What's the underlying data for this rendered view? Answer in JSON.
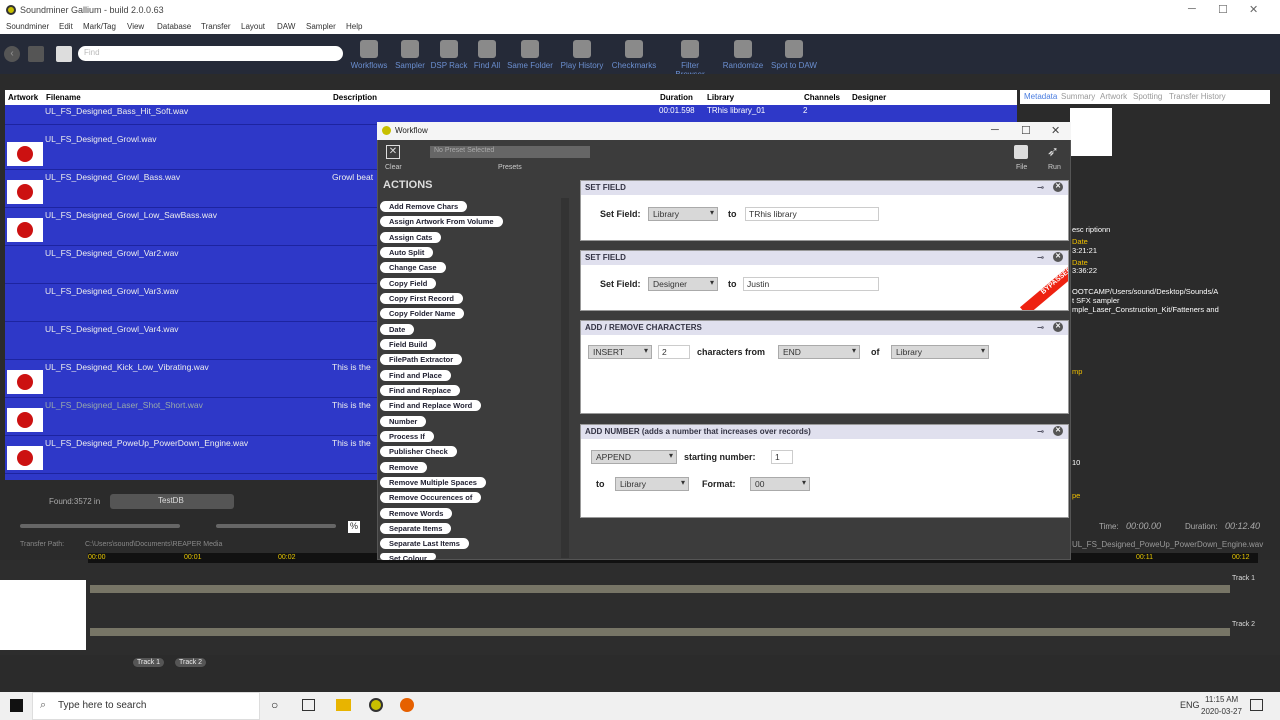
{
  "app": {
    "title": "Soundminer Gallium - build 2.0.0.63"
  },
  "menu": [
    "Soundminer",
    "Edit",
    "Mark/Tag",
    "View",
    "Database",
    "Transfer",
    "Layout",
    "DAW",
    "Sampler",
    "Help"
  ],
  "search": {
    "placeholder": "Find"
  },
  "toolbar": [
    "Workflows",
    "Sampler",
    "DSP Rack",
    "Find All",
    "Same Folder",
    "Play History",
    "Checkmarks",
    "Filter Browser",
    "Randomize",
    "Spot to DAW"
  ],
  "grid": {
    "columns": [
      "Artwork",
      "Filename",
      "Description",
      "Duration",
      "Library",
      "Channels",
      "Designer"
    ],
    "first": {
      "duration": "00:01.598",
      "library": "TRhis library_01",
      "channels": "2"
    },
    "rows": [
      {
        "file": "UL_FS_Designed_Bass_Hit_Soft.wav",
        "desc": ""
      },
      {
        "file": "UL_FS_Designed_Growl.wav",
        "desc": ""
      },
      {
        "file": "UL_FS_Designed_Growl_Bass.wav",
        "desc": "Growl beat"
      },
      {
        "file": "UL_FS_Designed_Growl_Low_SawBass.wav",
        "desc": ""
      },
      {
        "file": "UL_FS_Designed_Growl_Var2.wav",
        "desc": ""
      },
      {
        "file": "UL_FS_Designed_Growl_Var3.wav",
        "desc": ""
      },
      {
        "file": "UL_FS_Designed_Growl_Var4.wav",
        "desc": ""
      },
      {
        "file": "UL_FS_Designed_Kick_Low_Vibrating.wav",
        "desc": "This is the"
      },
      {
        "file": "UL_FS_Designed_Laser_Shot_Short.wav",
        "desc": "This is the"
      },
      {
        "file": "UL_FS_Designed_PoweUp_PowerDown_Engine.wav",
        "desc": "This is the"
      }
    ]
  },
  "right": {
    "tabs": [
      "Metadata",
      "Summary",
      "Artwork",
      "Spotting",
      "Transfer History"
    ],
    "lines": [
      "esc riptionn",
      "Date",
      "3:21:21",
      "Date",
      "3:36:22",
      "OOTCAMP/Users/sound/Desktop/Sounds/A",
      "t SFX sampler",
      "mple_Laser_Construction_Kit/Fatteners and",
      "mp",
      "10",
      "pe"
    ],
    "time_label": "Time:",
    "time": "00:00.00",
    "dur_label": "Duration:",
    "dur": "00:12.40",
    "file": "UL_FS_Designed_PoweUp_PowerDown_Engine.wav"
  },
  "footer": {
    "found": "Found:3572 in",
    "db": "TestDB",
    "transfer_label": "Transfer Path:",
    "transfer_path": "C:\\Users\\sound\\Documents\\REAPER Media",
    "pct": "%"
  },
  "workflow": {
    "title": "Workflow",
    "clear": "Clear",
    "preset": "No Preset Selected",
    "presets": "Presets",
    "file": "File",
    "run": "Run",
    "actions_title": "ACTIONS",
    "actions": [
      "Add Remove Chars",
      "Assign Artwork From Volume",
      "Assign Cats",
      "Auto Split",
      "Change Case",
      "Copy Field",
      "Copy First Record",
      "Copy Folder Name",
      "Date",
      "Field Build",
      "FilePath Extractor",
      "Find and Place",
      "Find and Replace",
      "Find and Replace Word",
      "Number",
      "Process If",
      "Publisher Check",
      "Remove",
      "Remove Multiple Spaces",
      "Remove Occurences of",
      "Remove Words",
      "Separate Items",
      "Separate Last Items",
      "Set Colour"
    ],
    "set1": {
      "title": "SET FIELD",
      "label": "Set Field:",
      "field": "Library",
      "to": "to",
      "value": "TRhis library"
    },
    "set2": {
      "title": "SET FIELD",
      "label": "Set Field:",
      "field": "Designer",
      "to": "to",
      "value": "Justin",
      "badge": "BYPASSED"
    },
    "addrem": {
      "title": "ADD / REMOVE CHARACTERS",
      "mode": "INSERT",
      "count": "2",
      "mid": "characters from",
      "pos": "END",
      "of": "of",
      "field": "Library"
    },
    "addnum": {
      "title": "ADD NUMBER (adds a number that increases over records)",
      "mode": "APPEND",
      "start_label": "starting number:",
      "start": "1",
      "to": "to",
      "field": "Library",
      "format_label": "Format:",
      "format": "00"
    }
  },
  "ruler": [
    "00:00",
    "00:01",
    "00:02",
    "00:11",
    "00:12"
  ],
  "tracks": {
    "t1": "Track 1",
    "t2": "Track 2",
    "b1": "Track 1",
    "b2": "Track 2"
  },
  "taskbar": {
    "search": "Type here to search",
    "lang": "ENG",
    "time": "11:15 AM",
    "date": "2020-03-27"
  }
}
